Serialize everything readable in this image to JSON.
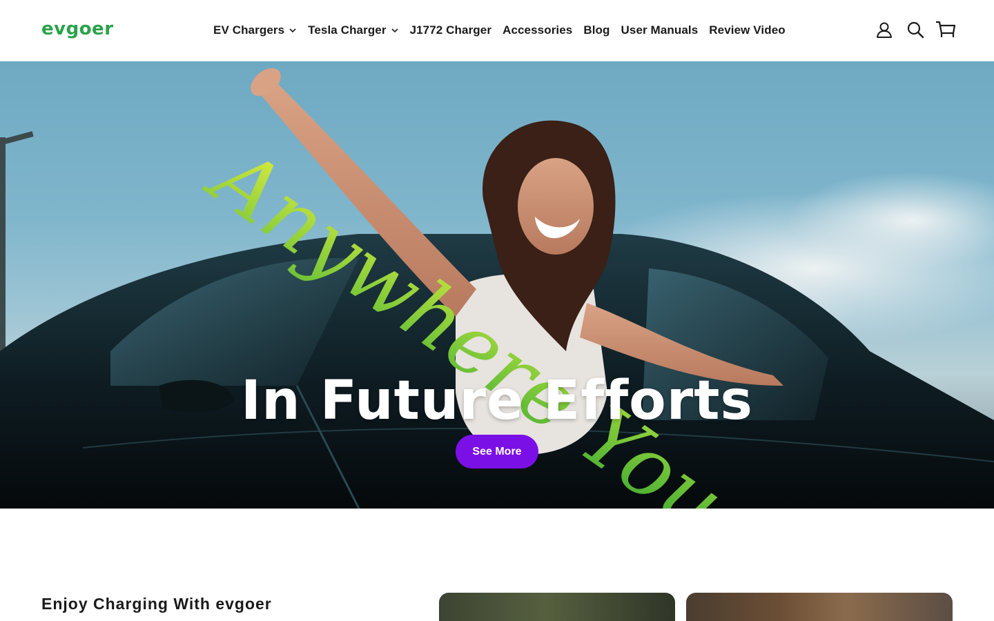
{
  "brand": {
    "logo_text": "evgoer",
    "accent_color": "#2aa24a"
  },
  "nav": {
    "items": [
      {
        "label": "EV Chargers",
        "has_dropdown": true
      },
      {
        "label": "Tesla Charger",
        "has_dropdown": true
      },
      {
        "label": "J1772 Charger",
        "has_dropdown": false
      },
      {
        "label": "Accessories",
        "has_dropdown": false
      },
      {
        "label": "Blog",
        "has_dropdown": false
      },
      {
        "label": "User Manuals",
        "has_dropdown": false
      },
      {
        "label": "Review Video",
        "has_dropdown": false
      }
    ]
  },
  "utility_icons": [
    "account-icon",
    "search-icon",
    "cart-icon"
  ],
  "hero": {
    "script_text": "Anywhere You Go",
    "title": "In Future Efforts",
    "cta_label": "See More",
    "cta_color": "#7a10e6"
  },
  "section": {
    "heading": "Enjoy Charging With evgoer"
  }
}
